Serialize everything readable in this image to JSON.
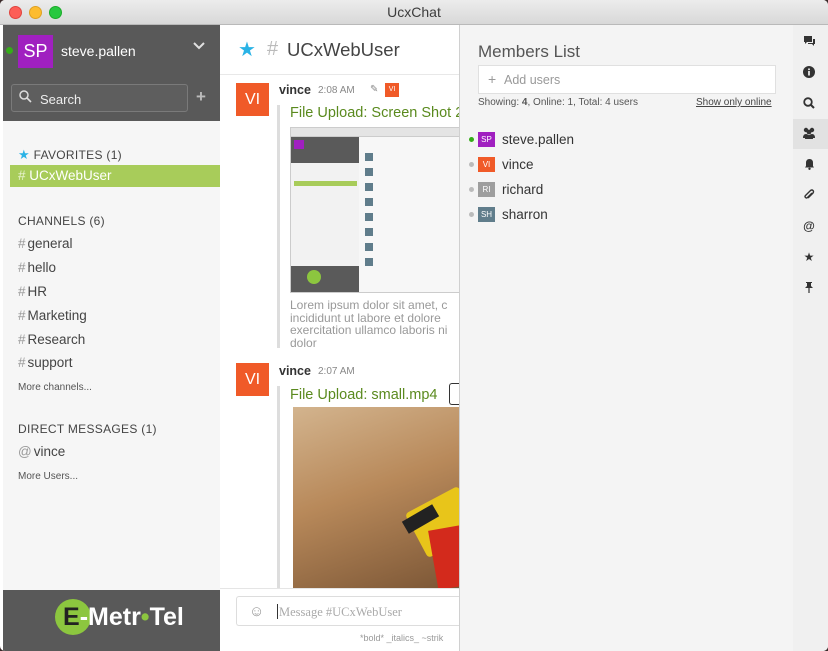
{
  "window": {
    "title": "UcxChat"
  },
  "sidebar": {
    "user": {
      "initials": "SP",
      "name": "steve.pallen"
    },
    "search_label": "Search",
    "favorites": {
      "heading": "FAVORITES (1)",
      "items": [
        {
          "label": "UCxWebUser"
        }
      ]
    },
    "channels": {
      "heading": "CHANNELS (6)",
      "items": [
        {
          "label": "general"
        },
        {
          "label": "hello"
        },
        {
          "label": "HR"
        },
        {
          "label": "Marketing"
        },
        {
          "label": "Research"
        },
        {
          "label": "support"
        }
      ],
      "more": "More channels..."
    },
    "direct": {
      "heading": "DIRECT MESSAGES (1)",
      "items": [
        {
          "label": "vince"
        }
      ],
      "more": "More Users..."
    },
    "logo": {
      "prefix": "E",
      "text": "-Metr",
      "o": "o",
      "suffix": "Tel"
    }
  },
  "main": {
    "channel_name": "UCxWebUser",
    "messages": [
      {
        "initials": "VI",
        "author": "vince",
        "time": "2:08 AM",
        "badge": "VI",
        "title": "File Upload: Screen Shot 2",
        "body": "Lorem ipsum dolor sit amet, c incididunt ut labore et dolore exercitation ullamco laboris ni dolor"
      },
      {
        "initials": "VI",
        "author": "vince",
        "time": "2:07 AM",
        "title": "File Upload: small.mp4"
      }
    ],
    "composer": {
      "placeholder": "Message #UCxWebUser",
      "hint": "*bold* _italics_ ~strik"
    }
  },
  "members": {
    "title": "Members List",
    "add_placeholder": "Add users",
    "stats": {
      "showing_label": "Showing:",
      "showing": "4",
      "online_label": "Online:",
      "online": "1",
      "total_label": "Total:",
      "total": "4",
      "suffix": "users"
    },
    "toggle": "Show only online",
    "list": [
      {
        "initials": "SP",
        "name": "steve.pallen",
        "color": "#a020c0",
        "online": true
      },
      {
        "initials": "VI",
        "name": "vince",
        "color": "#f05a28",
        "online": false
      },
      {
        "initials": "RI",
        "name": "richard",
        "color": "#9e9e9e",
        "online": false
      },
      {
        "initials": "SH",
        "name": "sharron",
        "color": "#607d8b",
        "online": false
      }
    ]
  },
  "right_bar": {
    "icons": [
      "chat-icon",
      "info-icon",
      "search-icon",
      "members-icon",
      "bell-icon",
      "paperclip-icon",
      "at-icon",
      "star-icon",
      "pin-icon"
    ]
  },
  "colors": {
    "accent_green": "#a8cc5a",
    "online": "#35ac19",
    "title_green": "#5a8a1e"
  }
}
